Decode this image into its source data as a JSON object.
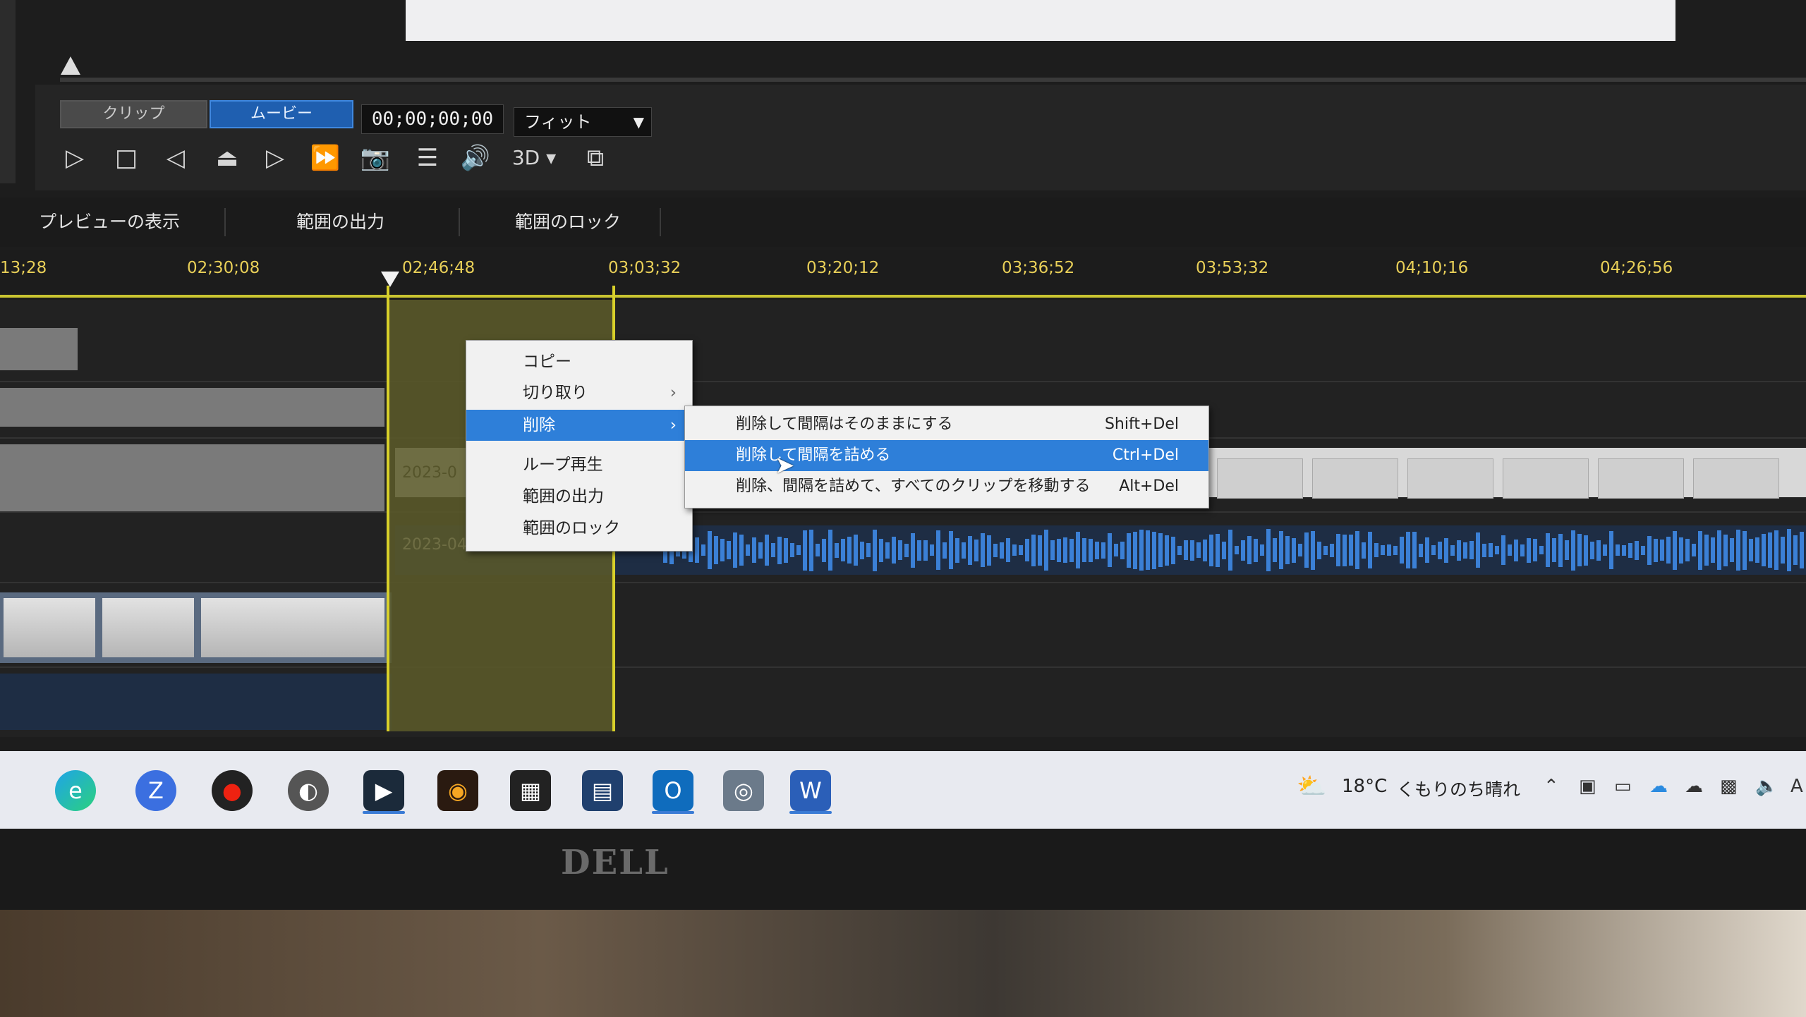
{
  "player": {
    "tab_clip": "クリップ",
    "tab_movie": "ムービー",
    "timecode": "00;00;00;00",
    "fit_label": "フィット",
    "mode_3d": "3D"
  },
  "range_bar": {
    "preview": "プレビューの表示",
    "output": "範囲の出力",
    "lock": "範囲のロック"
  },
  "ruler": {
    "ticks": [
      "13;28",
      "02;30;08",
      "02;46;48",
      "03;03;32",
      "03;20;12",
      "03;36;52",
      "03;53;32",
      "04;10;16",
      "04;26;56"
    ]
  },
  "tracks": {
    "title_clip_date": "2023-0",
    "audio_clip_date": "2023-04"
  },
  "context_menu": {
    "items": [
      {
        "label": "コピー",
        "has_submenu": false
      },
      {
        "label": "切り取り",
        "has_submenu": true
      },
      {
        "label": "削除",
        "has_submenu": true,
        "active": true
      },
      {
        "label": "ループ再生",
        "has_submenu": false
      },
      {
        "label": "範囲の出力",
        "has_submenu": false
      },
      {
        "label": "範囲のロック",
        "has_submenu": false
      }
    ]
  },
  "submenu": {
    "items": [
      {
        "label": "削除して間隔はそのままにする",
        "shortcut": "Shift+Del"
      },
      {
        "label": "削除して間隔を詰める",
        "shortcut": "Ctrl+Del",
        "active": true
      },
      {
        "label": "削除、間隔を詰めて、すべてのクリップを移動する",
        "shortcut": "Alt+Del"
      }
    ]
  },
  "taskbar": {
    "weather_temp": "18°C",
    "weather_desc": "くもりのち晴れ",
    "tray_letter": "A"
  },
  "monitor": {
    "brand": "DELL"
  },
  "colors": {
    "accent": "#2e7fd9",
    "range": "#d8d02a",
    "ruler_text": "#e8cf58"
  }
}
